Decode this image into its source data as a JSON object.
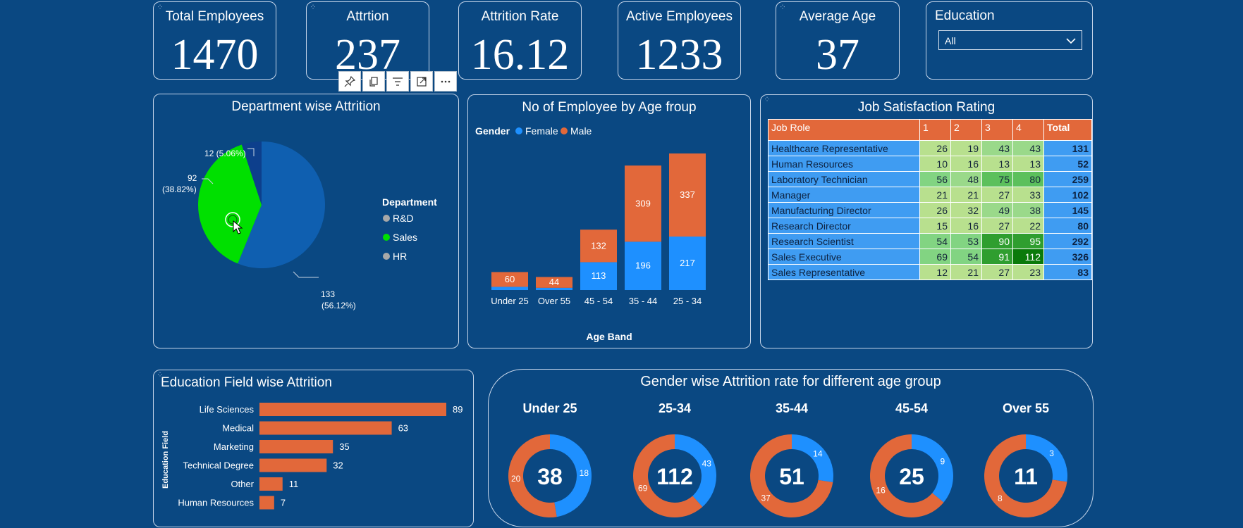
{
  "kpis": {
    "total_employees": {
      "title": "Total Employees",
      "value": "1470"
    },
    "attrition": {
      "title": "Attrtion",
      "value": "237"
    },
    "attrition_rate": {
      "title": "Attrition Rate",
      "value": "16.12"
    },
    "active_employees": {
      "title": "Active Employees",
      "value": "1233"
    },
    "average_age": {
      "title": "Average Age",
      "value": "37"
    }
  },
  "education_filter": {
    "title": "Education",
    "selected": "All"
  },
  "visual_toolbar": [
    "pin-icon",
    "copy-icon",
    "filter-icon",
    "focus-mode-icon",
    "more-options-icon"
  ],
  "dept_attrition": {
    "title": "Department wise Attrition",
    "legend_title": "Department",
    "legend": [
      "R&D",
      "Sales",
      "HR"
    ],
    "labels": {
      "hr": "12 (5.06%)",
      "sales_value": "92",
      "sales_pct": "(38.82%)",
      "rd_value": "133",
      "rd_pct": "(56.12%)"
    }
  },
  "age_group": {
    "title": "No of Employee by Age froup",
    "legend_title": "Gender",
    "legend": [
      "Female",
      "Male"
    ],
    "xlabel": "Age Band"
  },
  "job_satisfaction": {
    "title": "Job Satisfaction Rating",
    "headers": [
      "Job Role",
      "1",
      "2",
      "3",
      "4",
      "Total"
    ],
    "rows": [
      [
        "Healthcare Representative",
        "26",
        "19",
        "43",
        "43",
        "131"
      ],
      [
        "Human Resources",
        "10",
        "16",
        "13",
        "13",
        "52"
      ],
      [
        "Laboratory Technician",
        "56",
        "48",
        "75",
        "80",
        "259"
      ],
      [
        "Manager",
        "21",
        "21",
        "27",
        "33",
        "102"
      ],
      [
        "Manufacturing Director",
        "26",
        "32",
        "49",
        "38",
        "145"
      ],
      [
        "Research Director",
        "15",
        "16",
        "27",
        "22",
        "80"
      ],
      [
        "Research Scientist",
        "54",
        "53",
        "90",
        "95",
        "292"
      ],
      [
        "Sales Executive",
        "69",
        "54",
        "91",
        "112",
        "326"
      ],
      [
        "Sales Representative",
        "12",
        "21",
        "27",
        "23",
        "83"
      ]
    ]
  },
  "edu_field": {
    "title": "Education Field wise Attrition",
    "ylabel": "Education Field"
  },
  "gender_attrition": {
    "title": "Gender wise Attrition rate for different age group"
  },
  "colors": {
    "background": "#0a4882",
    "female": "#1e90ff",
    "male": "#e2683a",
    "rd": "#0f5fb0",
    "sales": "#00e000",
    "hr": "#0d3f8c"
  },
  "chart_data": [
    {
      "type": "pie",
      "title": "Department wise Attrition",
      "categories": [
        "R&D",
        "Sales",
        "HR"
      ],
      "values": [
        133,
        92,
        12
      ]
    },
    {
      "type": "bar",
      "title": "No of Employee by Age froup",
      "xlabel": "Age Band",
      "categories": [
        "Under 25",
        "Over 55",
        "45 - 54",
        "35 - 44",
        "25 - 34"
      ],
      "series": [
        {
          "name": "Female",
          "values": [
            13,
            9,
            113,
            196,
            217
          ]
        },
        {
          "name": "Male",
          "values": [
            60,
            44,
            132,
            309,
            337
          ]
        }
      ],
      "value_labels": {
        "Female": [
          "",
          "",
          "113",
          "196",
          "217"
        ],
        "Male": [
          "60",
          "44",
          "132",
          "309",
          "337"
        ]
      }
    },
    {
      "type": "bar",
      "title": "Education Field wise Attrition",
      "ylabel": "Education Field",
      "categories": [
        "Life Sciences",
        "Medical",
        "Marketing",
        "Technical Degree",
        "Other",
        "Human Resources"
      ],
      "values": [
        89,
        63,
        35,
        32,
        11,
        7
      ]
    },
    {
      "type": "pie",
      "title": "Gender wise Attrition rate for different age group",
      "groups": [
        {
          "name": "Under 25",
          "total": 38,
          "female": 18,
          "male": 20
        },
        {
          "name": "25-34",
          "total": 112,
          "female": 43,
          "male": 69
        },
        {
          "name": "35-44",
          "total": 51,
          "female": 14,
          "male": 37
        },
        {
          "name": "45-54",
          "total": 25,
          "female": 9,
          "male": 16
        },
        {
          "name": "Over 55",
          "total": 11,
          "female": 3,
          "male": 8
        }
      ]
    }
  ]
}
